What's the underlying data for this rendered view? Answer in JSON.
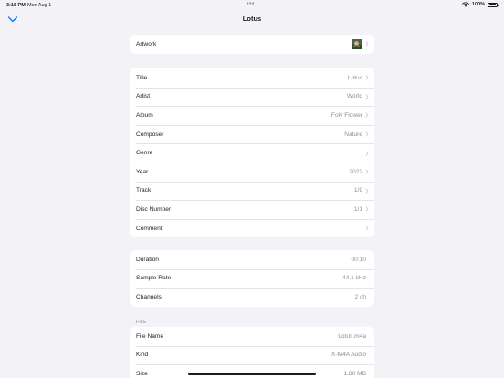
{
  "status": {
    "time": "3:18 PM",
    "date": "Mon Aug 1",
    "battery": "100%"
  },
  "nav": {
    "title": "Lotus"
  },
  "artwork": {
    "label": "Artwork"
  },
  "metadata": [
    {
      "label": "Title",
      "value": "Lotus"
    },
    {
      "label": "Artist",
      "value": "World"
    },
    {
      "label": "Album",
      "value": "Foly Flower"
    },
    {
      "label": "Composer",
      "value": "Nature"
    },
    {
      "label": "Genre",
      "value": ""
    },
    {
      "label": "Year",
      "value": "2022"
    },
    {
      "label": "Track",
      "value": "1/9"
    },
    {
      "label": "Disc Number",
      "value": "1/1"
    },
    {
      "label": "Comment",
      "value": ""
    }
  ],
  "audio": [
    {
      "label": "Duration",
      "value": "00:10"
    },
    {
      "label": "Sample Rate",
      "value": "44.1 kHz"
    },
    {
      "label": "Channels",
      "value": "2 ch"
    }
  ],
  "file": {
    "header": "FILE",
    "rows": [
      {
        "label": "File Name",
        "value": "Lotus.m4a"
      },
      {
        "label": "Kind",
        "value": "X-M4A Audio"
      },
      {
        "label": "Size",
        "value": "1.80 MB"
      }
    ]
  },
  "colors": {
    "accent": "#007aff",
    "background": "#f2f2f7",
    "secondary_text": "#8e8e93"
  }
}
